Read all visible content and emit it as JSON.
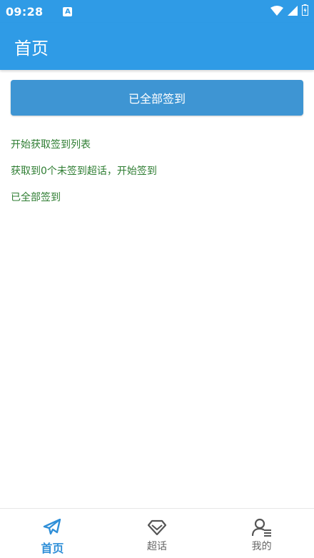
{
  "status_bar": {
    "time": "09:28",
    "notification_icon": "A",
    "icons": [
      "wifi-icon",
      "signal-icon",
      "battery-charging-icon"
    ]
  },
  "app_bar": {
    "title": "首页"
  },
  "main": {
    "signin_button_label": "已全部签到",
    "log_lines": [
      "开始获取签到列表",
      "获取到0个未签到超话，开始签到",
      "已全部签到"
    ]
  },
  "bottom_nav": {
    "items": [
      {
        "label": "首页",
        "icon": "paper-plane-icon",
        "active": true
      },
      {
        "label": "超话",
        "icon": "diamond-icon",
        "active": false
      },
      {
        "label": "我的",
        "icon": "user-list-icon",
        "active": false
      }
    ]
  },
  "colors": {
    "primary": "#2f9be6",
    "button": "#3e95d3",
    "log_text": "#2e7d32",
    "nav_active": "#2f8fd8",
    "nav_inactive": "#666666"
  }
}
